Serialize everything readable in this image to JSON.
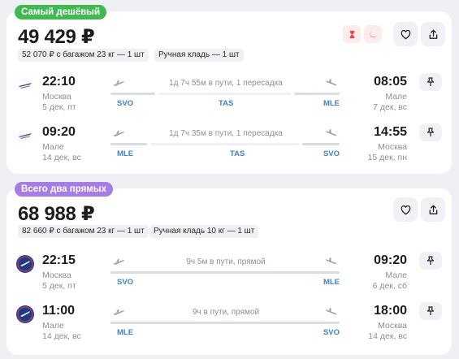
{
  "offers": [
    {
      "badge": "Самый дешёвый",
      "badge_color": "#3fb950",
      "price": "49 429 ₽",
      "chips": [
        "52 070 ₽ с багажом 23 кг — 1 шт",
        "Ручная кладь — 1 шт"
      ],
      "flights": [
        {
          "dep_time": "22:10",
          "dep_city": "Москва",
          "dep_date": "5 дек, пт",
          "arr_time": "08:05",
          "arr_city": "Мале",
          "arr_date": "7 дек, вс",
          "duration": "1д 7ч 55м в пути, 1 пересадка",
          "codes": [
            "SVO",
            "TAS",
            "MLE"
          ]
        },
        {
          "dep_time": "09:20",
          "dep_city": "Мале",
          "dep_date": "14 дек, вс",
          "arr_time": "14:55",
          "arr_city": "Москва",
          "arr_date": "15 дек, пн",
          "duration": "1д 7ч 35м в пути, 1 пересадка",
          "codes": [
            "MLE",
            "TAS",
            "SVO"
          ]
        }
      ]
    },
    {
      "badge": "Всего два прямых",
      "badge_color": "#a47de8",
      "price": "68 988 ₽",
      "chips": [
        "82 660 ₽ с багажом 23 кг — 1 шт",
        "Ручная кладь 10 кг — 1 шт"
      ],
      "flights": [
        {
          "dep_time": "22:15",
          "dep_city": "Москва",
          "dep_date": "5 дек, пт",
          "arr_time": "09:20",
          "arr_city": "Мале",
          "arr_date": "6 дек, сб",
          "duration": "9ч 5м в пути, прямой",
          "codes": [
            "SVO",
            "MLE"
          ]
        },
        {
          "dep_time": "11:00",
          "dep_city": "Мале",
          "dep_date": "14 дек, вс",
          "arr_time": "18:00",
          "arr_city": "Москва",
          "arr_date": "14 дек, вс",
          "duration": "9ч в пути, прямой",
          "codes": [
            "MLE",
            "SVO"
          ]
        }
      ]
    }
  ],
  "icons": {
    "favorite": "heart-icon",
    "share": "share-icon",
    "pin": "pin-icon",
    "night_transfer": "hourglass-icon",
    "night_flight": "moon-icon"
  },
  "colors": {
    "accent_code": "#3b82d6",
    "cheapest_badge": "#3fb950",
    "direct_badge": "#a47de8",
    "warning_icon": "#e5484d"
  }
}
